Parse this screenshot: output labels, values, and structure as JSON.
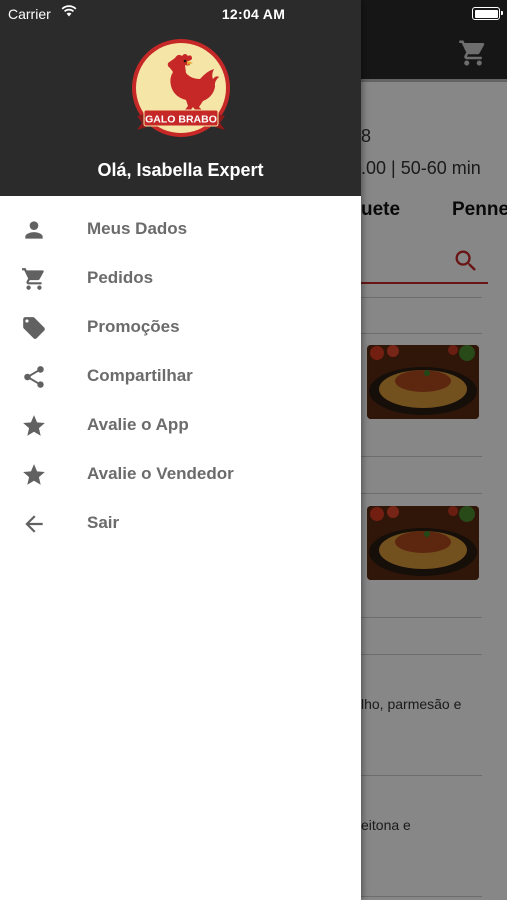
{
  "status_bar": {
    "carrier": "Carrier",
    "time": "12:04 AM"
  },
  "drawer": {
    "brand": "GALO BRABO",
    "greeting": "Olá, Isabella Expert",
    "menu": [
      {
        "label": "Meus Dados",
        "icon": "person-icon"
      },
      {
        "label": "Pedidos",
        "icon": "cart-icon"
      },
      {
        "label": "Promoções",
        "icon": "tag-icon"
      },
      {
        "label": "Compartilhar",
        "icon": "share-icon"
      },
      {
        "label": "Avalie o App",
        "icon": "star-icon"
      },
      {
        "label": "Avalie o Vendedor",
        "icon": "star-icon"
      },
      {
        "label": "Sair",
        "icon": "arrow-back-icon"
      }
    ]
  },
  "background": {
    "info_number": "8",
    "info_line": ".00 | 50-60 min",
    "categories": [
      "uete",
      "Penne"
    ],
    "descriptions": [
      "lho, parmesão e",
      "eitona e"
    ]
  },
  "colors": {
    "header_bg": "#2b2b2b",
    "accent_red": "#c62828",
    "menu_text": "#6b6b6b",
    "icon_gray": "#616161"
  }
}
